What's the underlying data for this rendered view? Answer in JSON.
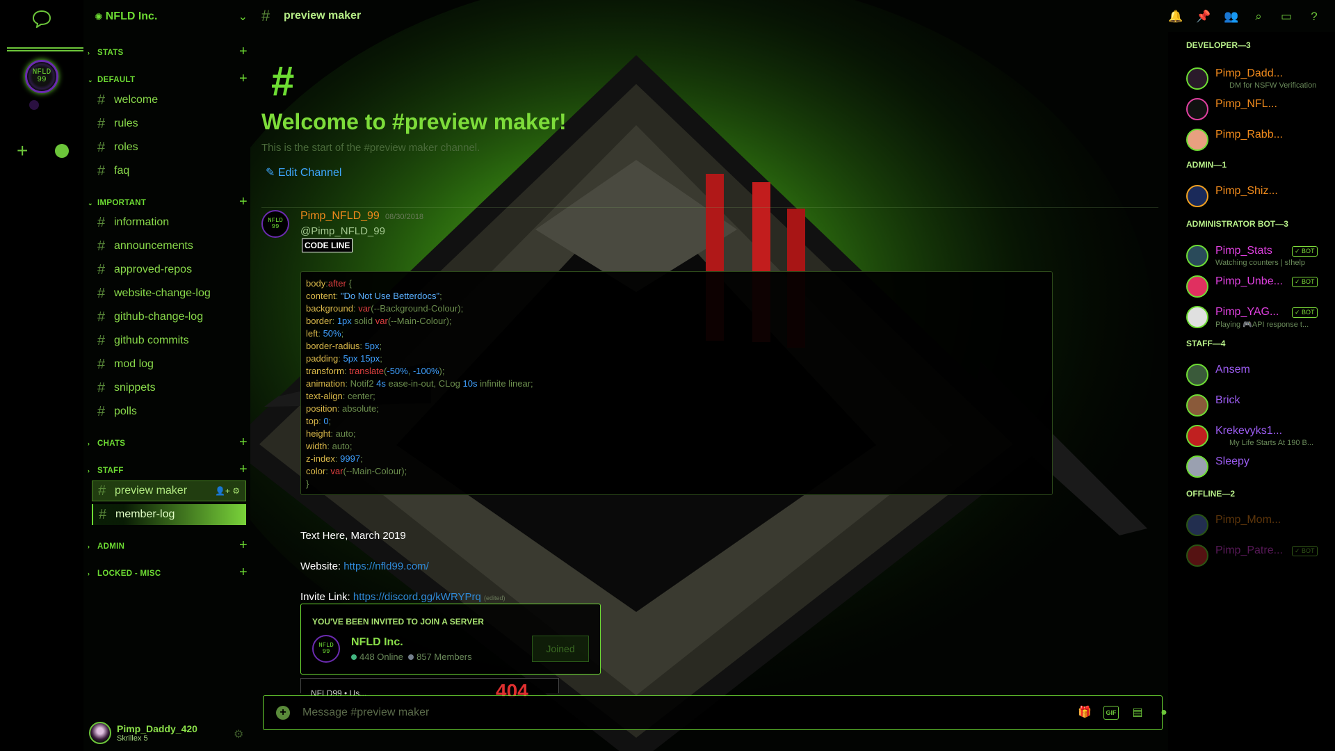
{
  "server": {
    "name": "NFLD Inc.",
    "icon_text": "NFLD\n99"
  },
  "categories": {
    "stats": "STATS",
    "default": "DEFAULT",
    "important": "IMPORTANT",
    "chats": "CHATS",
    "staff": "STAFF",
    "admin": "ADMIN",
    "locked": "LOCKED - MISC"
  },
  "channels": {
    "default": [
      "welcome",
      "rules",
      "roles",
      "faq"
    ],
    "important": [
      "information",
      "announcements",
      "approved-repos",
      "website-change-log",
      "github-change-log",
      "github commits",
      "mod log",
      "snippets",
      "polls"
    ],
    "staff": [
      "preview maker",
      "member-log"
    ]
  },
  "user": {
    "name": "Pimp_Daddy_420",
    "status": "Skrillex 5"
  },
  "header": {
    "channel": "preview maker"
  },
  "welcome": {
    "hash": "#",
    "title": "Welcome to #preview maker!",
    "subtitle": "This is the start of the #preview maker channel.",
    "edit": "Edit Channel"
  },
  "message": {
    "author": "Pimp_NFLD_99",
    "timestamp": "08/30/2018",
    "mention": "@Pimp_NFLD_99",
    "code_label": "CODE LINE",
    "text_line": "Text Here, March 2019",
    "website_label": "Website:",
    "website_url": "https://nfld99.com/",
    "invite_label": "Invite Link:",
    "invite_url": "https://discord.gg/kWRYPrq",
    "edited": "(edited)"
  },
  "invite": {
    "heading": "YOU'VE BEEN INVITED TO JOIN A SERVER",
    "name": "NFLD Inc.",
    "online": "448 Online",
    "members": "857 Members",
    "button": "Joined",
    "online_color": "#43b581",
    "members_color": "#747f8d"
  },
  "partial_embed": {
    "left": "NFLD99 • Us...",
    "right": "404"
  },
  "composer": {
    "placeholder": "Message #preview maker"
  },
  "member_list": {
    "groups": [
      {
        "title": "DEVELOPER—3",
        "members": [
          {
            "name": "Pimp_Dadd...",
            "activity": "DM for NSFW Verification",
            "bot": false,
            "color": "#f08a1c"
          },
          {
            "name": "Pimp_NFL...",
            "activity": "",
            "bot": false,
            "color": "#f08a1c"
          },
          {
            "name": "Pimp_Rabb...",
            "activity": "",
            "bot": false,
            "color": "#f08a1c"
          }
        ]
      },
      {
        "title": "ADMIN—1",
        "members": [
          {
            "name": "Pimp_Shiz...",
            "activity": "",
            "bot": false,
            "color": "#f08a1c"
          }
        ]
      },
      {
        "title": "ADMINISTRATOR BOT—3",
        "members": [
          {
            "name": "Pimp_Stats",
            "activity": "Watching counters | s!help",
            "bot": true,
            "color": "#e040e0"
          },
          {
            "name": "Pimp_Unbe...",
            "activity": "",
            "bot": true,
            "color": "#e040e0"
          },
          {
            "name": "Pimp_YAG...",
            "activity": "Playing 🎮API response t...",
            "bot": true,
            "color": "#e040e0"
          }
        ]
      },
      {
        "title": "STAFF—4",
        "members": [
          {
            "name": "Ansem",
            "activity": "",
            "bot": false,
            "color": "#9b5cf0"
          },
          {
            "name": "Brick",
            "activity": "",
            "bot": false,
            "color": "#9b5cf0"
          },
          {
            "name": "Krekevyks1...",
            "activity": "My Life Starts At 190 B...",
            "bot": false,
            "color": "#9b5cf0"
          },
          {
            "name": "Sleepy",
            "activity": "",
            "bot": false,
            "color": "#9b5cf0"
          }
        ]
      },
      {
        "title": "OFFLINE—2",
        "members": [
          {
            "name": "Pimp_Mom...",
            "activity": "",
            "bot": false,
            "color": "#f08a1c"
          },
          {
            "name": "Pimp_Patre...",
            "activity": "",
            "bot": true,
            "color": "#e040e0"
          }
        ]
      }
    ],
    "bot_tag": "✓ BOT"
  },
  "colors": {
    "accent": "#6ddc33",
    "author": "#f08a1c",
    "link": "#3ea8ff"
  }
}
